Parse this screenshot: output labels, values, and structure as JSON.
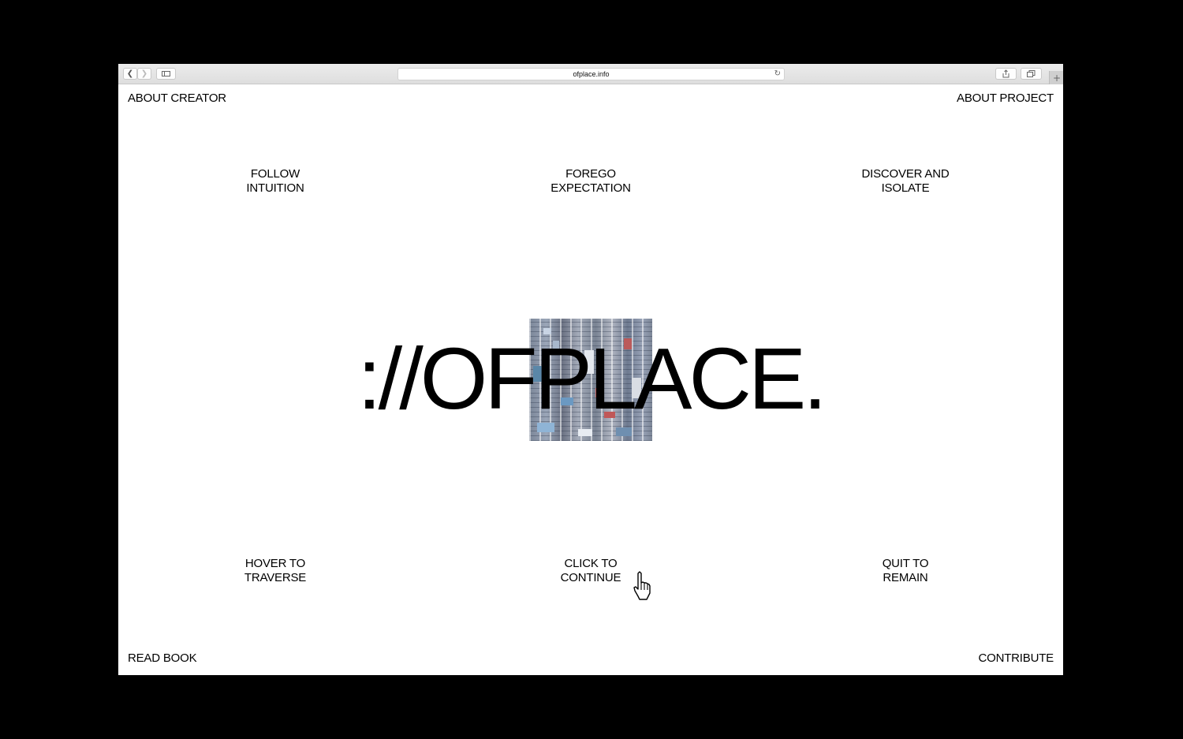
{
  "browser": {
    "url": "ofplace.info",
    "icons": [
      "back-icon",
      "forward-icon",
      "sidebar-icon",
      "reload-icon",
      "share-icon",
      "tabs-icon",
      "new-tab-icon"
    ]
  },
  "nav": {
    "about_creator": "ABOUT CREATOR",
    "about_project": "ABOUT PROJECT",
    "read_book": "READ BOOK",
    "contribute": "CONTRIBUTE"
  },
  "phrases": {
    "top_left": "FOLLOW\nINTUITION",
    "top_center": "FOREGO\nEXPECTATION",
    "top_right": "DISCOVER AND\nISOLATE",
    "bottom_left": "HOVER TO\nTRAVERSE",
    "bottom_center": "CLICK TO\nCONTINUE",
    "bottom_right": "QUIT TO\nREMAIN"
  },
  "hero": {
    "title": "://OFPLACE."
  },
  "colors": {
    "background": "#000000",
    "page": "#ffffff",
    "text": "#000000"
  }
}
